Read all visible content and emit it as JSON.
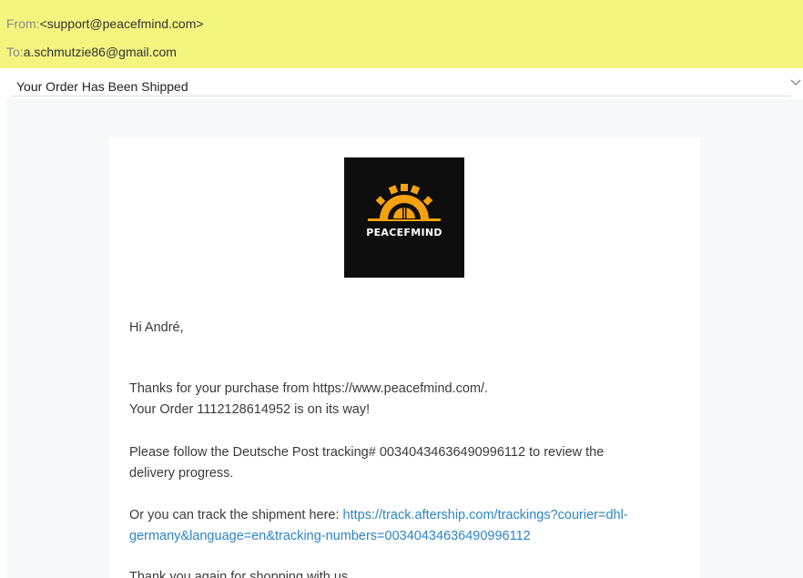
{
  "email": {
    "from_label": "From:",
    "from_value": "<support@peacefmind.com>",
    "to_label": "To:",
    "to_value": "a.schmutzie86@gmail.com",
    "subject": "Your Order Has Been Shipped"
  },
  "logo": {
    "text": "PEACEFMIND",
    "accent_color": "#f5a20d"
  },
  "body": {
    "greeting": "Hi André,",
    "thanks_line": "Thanks for your purchase from https://www.peacefmind.com/.",
    "order_line": "Your Order 1112128614952 is on its way!",
    "tracking_line_1": "Please follow the Deutsche Post tracking# 00340434636490996112 to review the",
    "tracking_line_2": "delivery progress.",
    "track_prefix": "Or you can track the shipment here: ",
    "track_link_1": "https://track.aftership.com/trackings?courier=dhl-",
    "track_link_2": "germany&language=en&tracking-numbers=00340434636490996112",
    "closing": "Thank you again for shopping with us."
  },
  "colors": {
    "header_bg": "#f3f57f",
    "link": "#2b86c5",
    "logo_bg": "#0e0e0e"
  },
  "icons": {
    "expand": "chevron-down-icon"
  }
}
